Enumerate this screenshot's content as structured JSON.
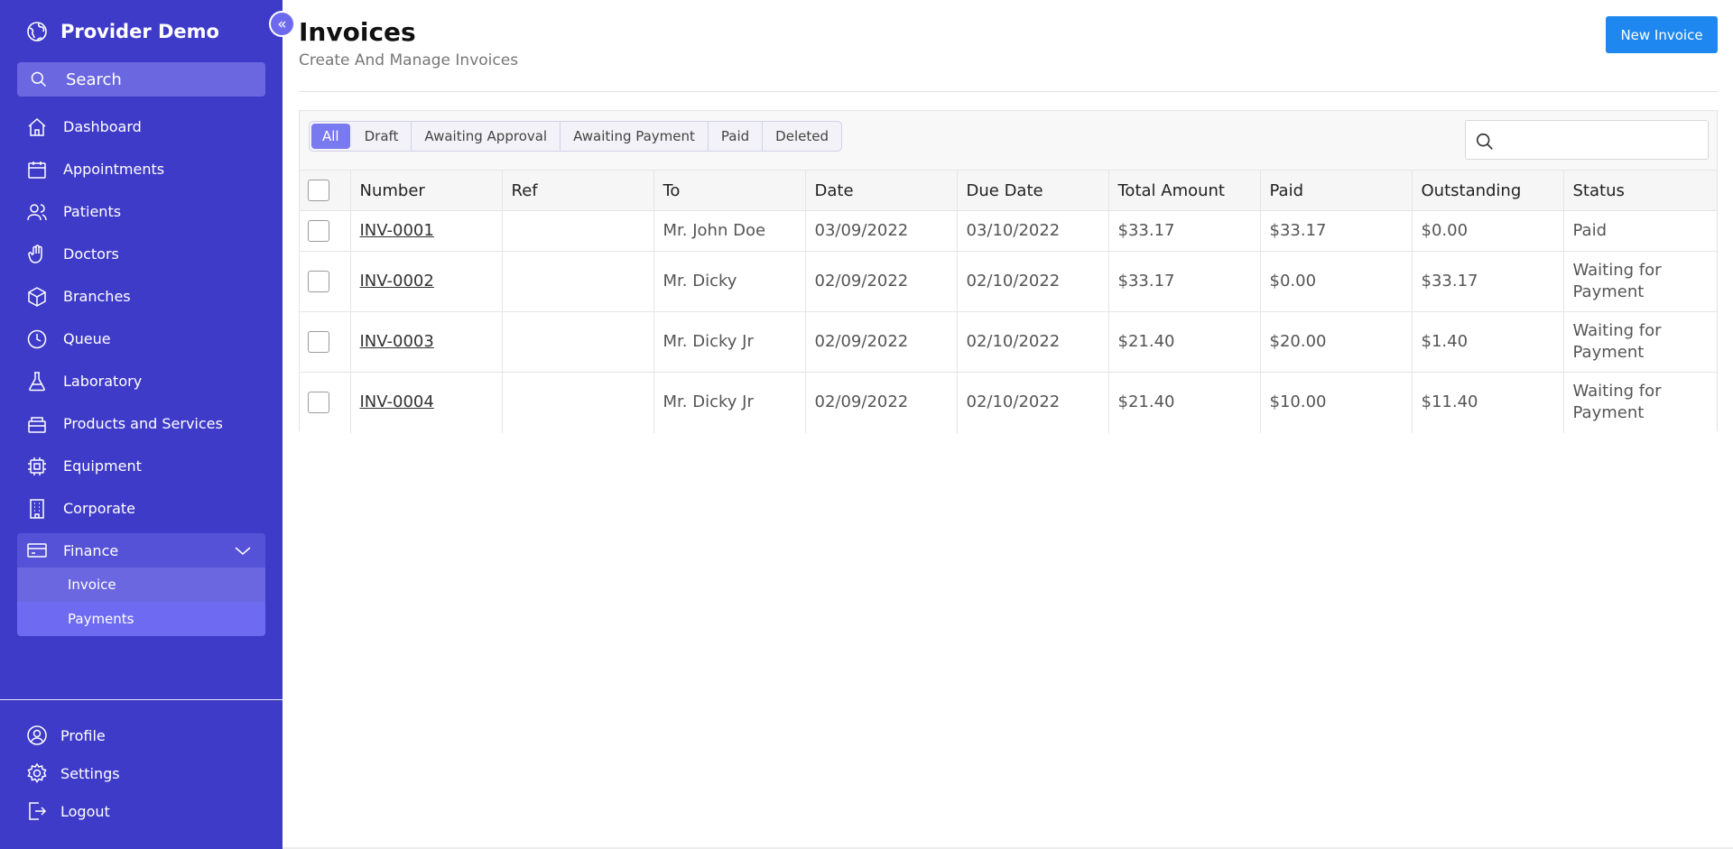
{
  "app": {
    "name": "Provider Demo"
  },
  "sidebar": {
    "search_label": "Search",
    "items": [
      {
        "label": "Dashboard",
        "icon": "home-icon"
      },
      {
        "label": "Appointments",
        "icon": "calendar-icon"
      },
      {
        "label": "Patients",
        "icon": "users-icon"
      },
      {
        "label": "Doctors",
        "icon": "hand-icon"
      },
      {
        "label": "Branches",
        "icon": "cube-icon"
      },
      {
        "label": "Queue",
        "icon": "clock-icon"
      },
      {
        "label": "Laboratory",
        "icon": "flask-icon"
      },
      {
        "label": "Products and Services",
        "icon": "box-icon"
      },
      {
        "label": "Equipment",
        "icon": "cpu-icon"
      },
      {
        "label": "Corporate",
        "icon": "building-icon"
      }
    ],
    "finance": {
      "label": "Finance",
      "icon": "credit-card-icon",
      "sub_items": [
        {
          "label": "Invoice"
        },
        {
          "label": "Payments"
        }
      ]
    },
    "bottom_items": [
      {
        "label": "Profile",
        "icon": "user-circle-icon"
      },
      {
        "label": "Settings",
        "icon": "gear-icon"
      },
      {
        "label": "Logout",
        "icon": "logout-icon"
      }
    ]
  },
  "header": {
    "title": "Invoices",
    "subtitle": "Create And Manage Invoices",
    "new_button": "New Invoice"
  },
  "filters": {
    "tabs": [
      "All",
      "Draft",
      "Awaiting Approval",
      "Awaiting Payment",
      "Paid",
      "Deleted"
    ],
    "active": "All"
  },
  "table": {
    "columns": [
      "Number",
      "Ref",
      "To",
      "Date",
      "Due Date",
      "Total Amount",
      "Paid",
      "Outstanding",
      "Status"
    ],
    "rows": [
      {
        "number": "INV-0001",
        "ref": "",
        "to": "Mr. John Doe",
        "date": "03/09/2022",
        "due": "03/10/2022",
        "total": "$33.17",
        "paid": "$33.17",
        "outstanding": "$0.00",
        "status": "Paid"
      },
      {
        "number": "INV-0002",
        "ref": "",
        "to": "Mr. Dicky",
        "date": "02/09/2022",
        "due": "02/10/2022",
        "total": "$33.17",
        "paid": "$0.00",
        "outstanding": "$33.17",
        "status": "Waiting for Payment"
      },
      {
        "number": "INV-0003",
        "ref": "",
        "to": "Mr. Dicky Jr",
        "date": "02/09/2022",
        "due": "02/10/2022",
        "total": "$21.40",
        "paid": "$20.00",
        "outstanding": "$1.40",
        "status": "Waiting for Payment"
      },
      {
        "number": "INV-0004",
        "ref": "",
        "to": "Mr. Dicky Jr",
        "date": "02/09/2022",
        "due": "02/10/2022",
        "total": "$21.40",
        "paid": "$10.00",
        "outstanding": "$11.40",
        "status": "Waiting for Payment"
      }
    ]
  },
  "colors": {
    "sidebar": "#3f3bc9",
    "accent": "#1e88f0",
    "tab_active": "#7a7af0"
  }
}
